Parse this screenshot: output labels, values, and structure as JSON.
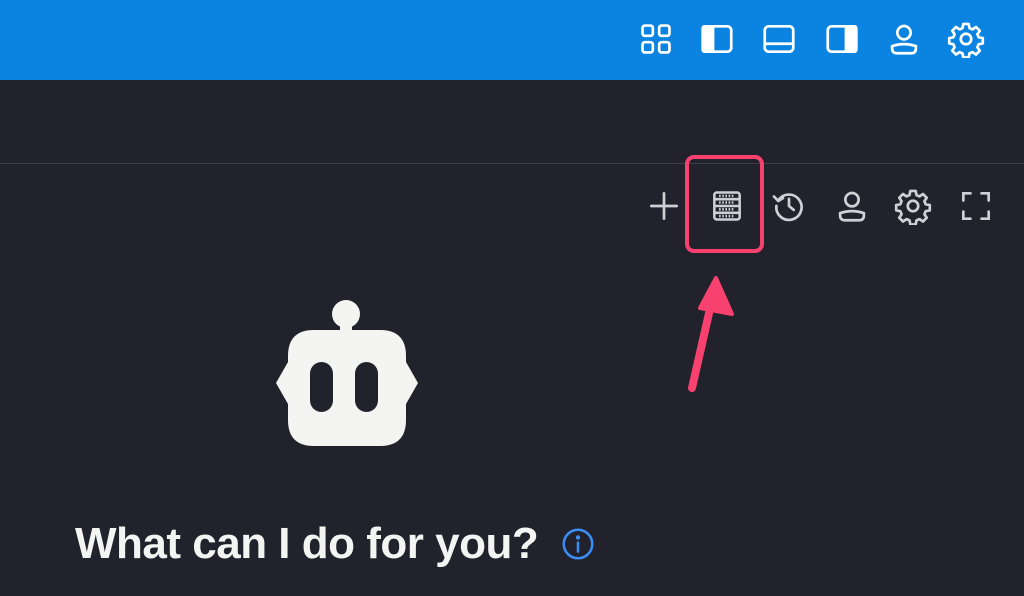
{
  "colors": {
    "titlebar_bg": "#0a84e0",
    "panel_bg": "#22222c",
    "icon_light": "#ffffff",
    "icon_muted": "#cfd0d6",
    "highlight": "#f7416e",
    "info_accent": "#3a8ef5",
    "logo_fill": "#f4f4f2"
  },
  "titlebar": {
    "icons": [
      "grid-icon",
      "left-sidebar-icon",
      "bottom-panel-icon",
      "right-sidebar-icon",
      "account-icon",
      "settings-icon"
    ]
  },
  "panel_toolbar": {
    "icons": [
      "plus-icon",
      "database-icon",
      "history-icon",
      "account-icon",
      "settings-icon",
      "fullscreen-icon"
    ],
    "highlighted": "database-icon"
  },
  "welcome": {
    "title": "What can I do for you?",
    "info_icon": "info-icon"
  },
  "logo": "robot-icon"
}
